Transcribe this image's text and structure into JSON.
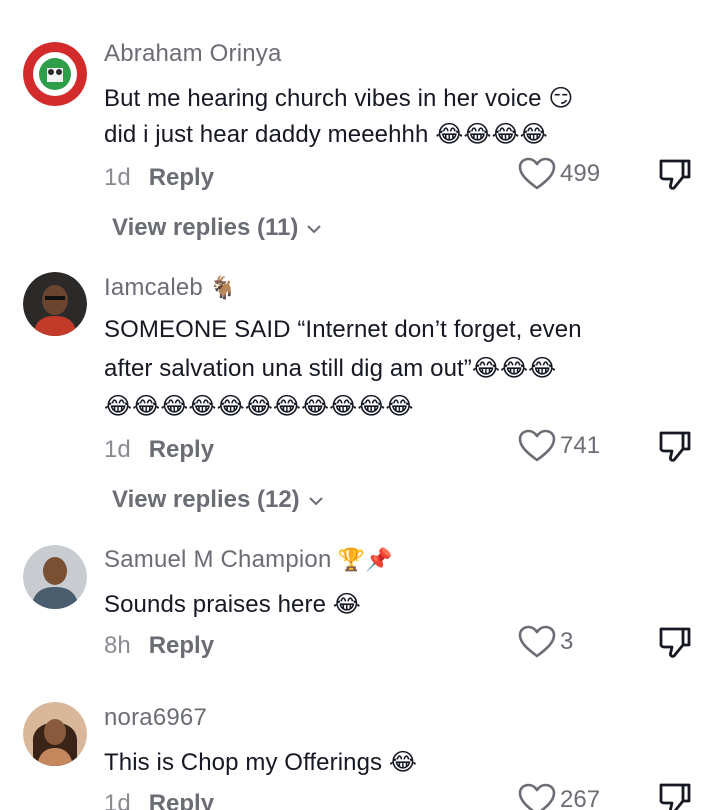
{
  "comments": [
    {
      "username": "Abraham Orinya",
      "badge": "",
      "lines": [
        "But me hearing church vibes in her voice 😏",
        "did i just hear daddy meeehhh 😂😂😂😂"
      ],
      "time": "1d",
      "reply_label": "Reply",
      "likes": "499",
      "view_replies": "View replies (11)"
    },
    {
      "username": "Iamcaleb",
      "badge": "🐐",
      "lines": [
        "SOMEONE SAID “Internet don’t forget, even",
        "after salvation una still dig am out”😂😂😂",
        "😂😂😂😂😂😂😂😂😂😂😂"
      ],
      "time": "1d",
      "reply_label": "Reply",
      "likes": "741",
      "view_replies": "View replies (12)"
    },
    {
      "username": "Samuel M Champion",
      "badge": "🏆📌",
      "lines": [
        "Sounds praises here 😂"
      ],
      "time": "8h",
      "reply_label": "Reply",
      "likes": "3",
      "view_replies": ""
    },
    {
      "username": "nora6967",
      "badge": "",
      "lines": [
        "This is Chop my Offerings 😂"
      ],
      "time": "1d",
      "reply_label": "Reply",
      "likes": "267",
      "view_replies": ""
    }
  ],
  "icons": {
    "like": "heart-outline-icon",
    "dislike": "thumbs-down-icon",
    "chevron": "chevron-down-icon"
  },
  "colors": {
    "username": "#6b6d74",
    "text": "#161823",
    "meta": "#8a8b91"
  }
}
